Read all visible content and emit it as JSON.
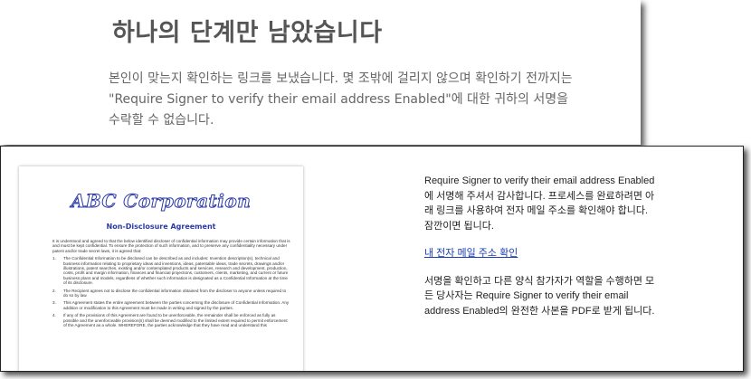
{
  "top": {
    "title": "하나의 단계만 남았습니다",
    "body": "본인이 맞는지 확인하는 링크를 보냈습니다. 몇 조밖에 걸리지 않으며 확인하기 전까지는 \"Require Signer to verify their email address Enabled\"에 대한 귀하의 서명을 수락할 수 없습니다."
  },
  "document": {
    "logo": "ABC Corporation",
    "heading": "Non-Disclosure Agreement",
    "intro": "It is understood and agreed to that the below identified discloser of confidential information may provide certain information that is and must be kept confidential. To ensure the protection of such information, and to preserve any confidentiality necessary under patent and/or trade secret laws, it is agreed that:",
    "items": [
      {
        "num": "1.",
        "text": "The Confidential Information to be disclosed can be described as and includes: Invention description(s), technical and business information relating to proprietary ideas and inventions, ideas, patentable ideas, trade secrets, drawings and/or illustrations, patent searches, existing and/or contemplated products and services, research and development, production, costs, profit and margin information, finances and financial projections, customers, clients, marketing, and current or future business plans and models, regardless of whether such information is designated as a Confidential Information at the time of its disclosure."
      },
      {
        "num": "2.",
        "text": "The Recipient agrees not to disclose the confidential information obtained from the discloser to anyone unless required to do so by law."
      },
      {
        "num": "3.",
        "text": "This Agreement states the entire agreement between the parties concerning the disclosure of Confidential Information. Any addition or modification to this Agreement must be made in writing and signed by the parties."
      },
      {
        "num": "4.",
        "text": "If any of the provisions of this Agreement are found to be unenforceable, the remainder shall be enforced as fully as possible and the unenforceable provision(s) shall be deemed modified to the limited extent required to permit enforcement of the Agreement as a whole. WHEREFORE, the parties acknowledge that they have read and understand this"
      }
    ]
  },
  "info": {
    "paragraph1": "Require Signer to verify their email address Enabled에 서명해 주셔서 감사합니다. 프로세스를 완료하려면 아래 링크를 사용하여 전자 메일 주소를 확인해야 합니다. 잠깐이면 됩니다.",
    "link_label": "내 전자 메일 주소 확인",
    "paragraph2": "서명을 확인하고 다른 양식 참가자가 역할을 수행하면 모든 당사자는 Require Signer to verify their email address Enabled의 완전한 사본을 PDF로 받게 됩니다."
  },
  "colors": {
    "title_gray": "#555555",
    "body_gray": "#666666",
    "link_blue": "#1a3fb3",
    "logo_blue": "#2a3aa8"
  }
}
